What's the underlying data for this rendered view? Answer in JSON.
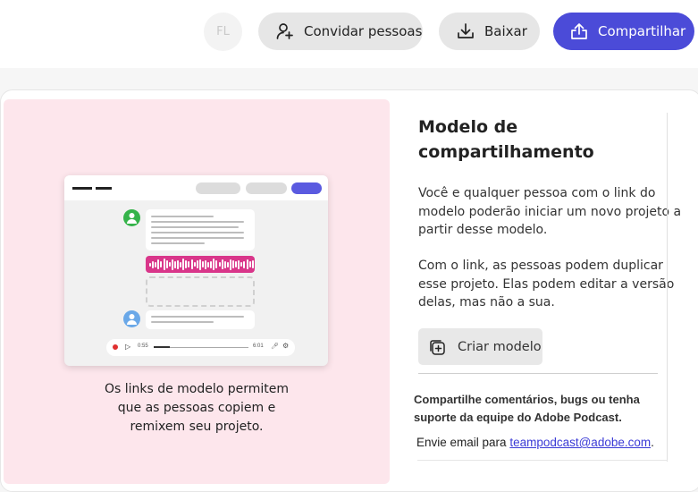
{
  "header": {
    "avatar_initials": "FL",
    "invite_label": "Convidar pessoas",
    "download_label": "Baixar",
    "share_label": "Compartilhar",
    "share_color": "#4b4bd8"
  },
  "preview": {
    "background_color": "#fde6ec",
    "mock_player": {
      "time_start": "0:55",
      "time_end": "6:01"
    },
    "caption_lines": [
      "Os links de modelo permitem",
      "que as pessoas copiem e",
      "remixem seu projeto."
    ]
  },
  "panel": {
    "title_lines": [
      "Modelo de",
      "compartilhamento"
    ],
    "paragraph1_lines": [
      "Você e qualquer pessoa com o link do",
      "modelo poderão iniciar um novo projeto a",
      "partir desse modelo."
    ],
    "paragraph2_lines": [
      "Com o link, as pessoas podem duplicar",
      "esse projeto. Elas podem editar a versão",
      "delas, mas não a sua."
    ],
    "create_button_label": "Criar modelo",
    "support_lines": [
      "Compartilhe comentários, bugs ou tenha",
      "suporte da equipe do Adobe Podcast."
    ],
    "email_prefix": "Envie email para ",
    "email_link": "teampodcast@adobe.com",
    "email_suffix": "."
  },
  "icons": {
    "invite": "add-person-icon",
    "download": "download-icon",
    "share": "share-upload-icon",
    "create": "duplicate-add-icon"
  }
}
